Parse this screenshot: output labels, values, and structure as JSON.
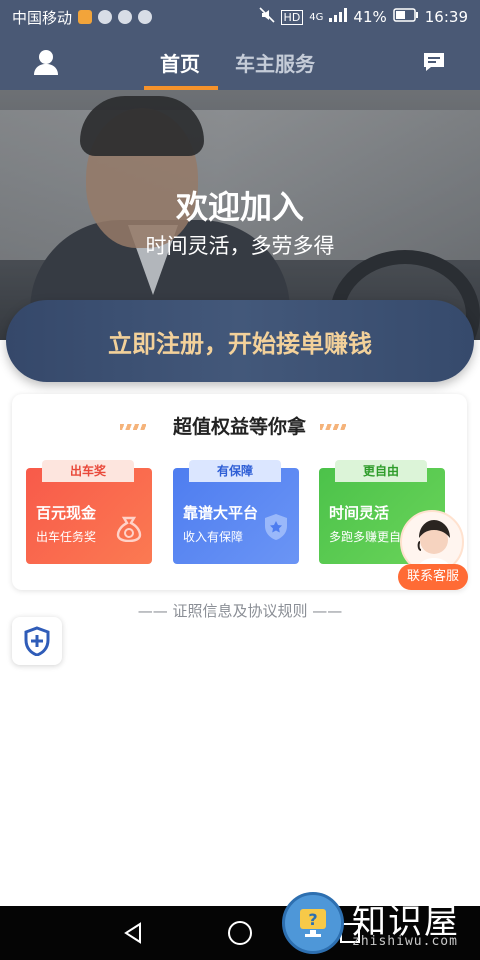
{
  "status_bar": {
    "carrier": "中国移动",
    "network": "4G",
    "hd": "HD",
    "battery": "41%",
    "time": "16:39"
  },
  "nav": {
    "tabs": [
      {
        "label": "首页",
        "active": true
      },
      {
        "label": "车主服务",
        "active": false
      }
    ],
    "user_icon": "user-icon",
    "message_icon": "message-icon"
  },
  "hero": {
    "title": "欢迎加入",
    "subtitle": "时间灵活，多劳多得"
  },
  "cta": {
    "label": "立即注册，开始接单赚钱"
  },
  "benefits": {
    "title": "超值权益等你拿",
    "cards": [
      {
        "tag": "出车奖",
        "title": "百元现金",
        "subtitle": "出车任务奖",
        "color": "#f85a4a",
        "icon": "money-bag-icon"
      },
      {
        "tag": "有保障",
        "title": "靠谱大平台",
        "subtitle": "收入有保障",
        "color": "#4e7df0",
        "icon": "shield-star-icon"
      },
      {
        "tag": "更自由",
        "title": "时间灵活",
        "subtitle": "多跑多赚更自由",
        "color": "#4cc24a",
        "icon": "clock-icon"
      }
    ]
  },
  "license_line": "—— 证照信息及协议规则 ——",
  "customer_service": {
    "label": "联系客服"
  },
  "watermark": {
    "text": "知识屋",
    "url": "zhishiwu.com"
  },
  "colors": {
    "header_bg": "#4a5975",
    "accent_orange": "#f5922b",
    "cta_text": "#f3d19a",
    "service_orange": "#ff6b35"
  }
}
